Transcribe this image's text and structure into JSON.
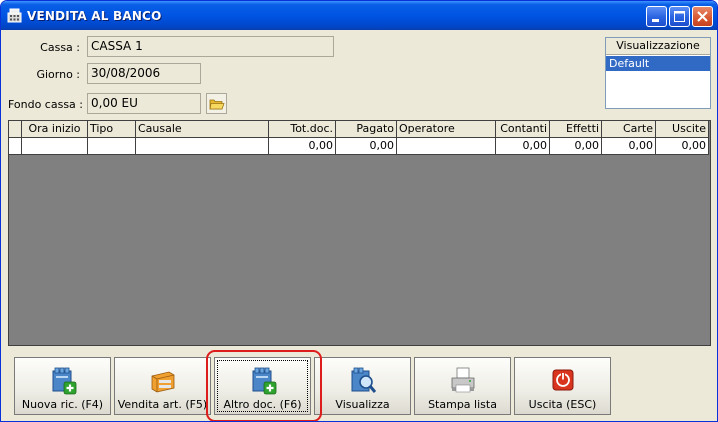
{
  "window": {
    "title": "VENDITA AL BANCO",
    "controls": [
      "minimize-icon",
      "maximize-icon",
      "close-icon"
    ]
  },
  "form": {
    "cassa_label": "Cassa :",
    "cassa_value": "CASSA 1",
    "giorno_label": "Giorno :",
    "giorno_value": "30/08/2006",
    "fondo_label": "Fondo cassa :",
    "fondo_value": "0,00 EU"
  },
  "visualizzazione": {
    "header": "Visualizzazione",
    "items": [
      "Default"
    ],
    "selected": "Default"
  },
  "grid": {
    "columns": [
      "Ora inizio",
      "Tipo",
      "Causale",
      "Tot.doc.",
      "Pagato",
      "Operatore",
      "Contanti",
      "Effetti",
      "Carte",
      "Uscite"
    ],
    "rows": [
      [
        "",
        "",
        "",
        "0,00",
        "0,00",
        "",
        "0,00",
        "0,00",
        "0,00",
        "0,00"
      ]
    ]
  },
  "buttons": [
    {
      "label": "Nuova ric. (F4)",
      "icon": "folder-add-icon"
    },
    {
      "label": "Vendita art. (F5)",
      "icon": "product-box-icon"
    },
    {
      "label": "Altro doc. (F6)",
      "icon": "folder-add-icon",
      "focused": true,
      "highlighted": true
    },
    {
      "label": "Visualizza",
      "icon": "folder-search-icon"
    },
    {
      "label": "Stampa lista",
      "icon": "printer-icon"
    },
    {
      "label": "Uscita (ESC)",
      "icon": "power-icon"
    }
  ],
  "colors": {
    "titlebar": "#0054e3",
    "window_bg": "#ece9d8",
    "grid_bg": "#808080",
    "selection": "#316ac5",
    "highlight": "#dd1c1c"
  }
}
